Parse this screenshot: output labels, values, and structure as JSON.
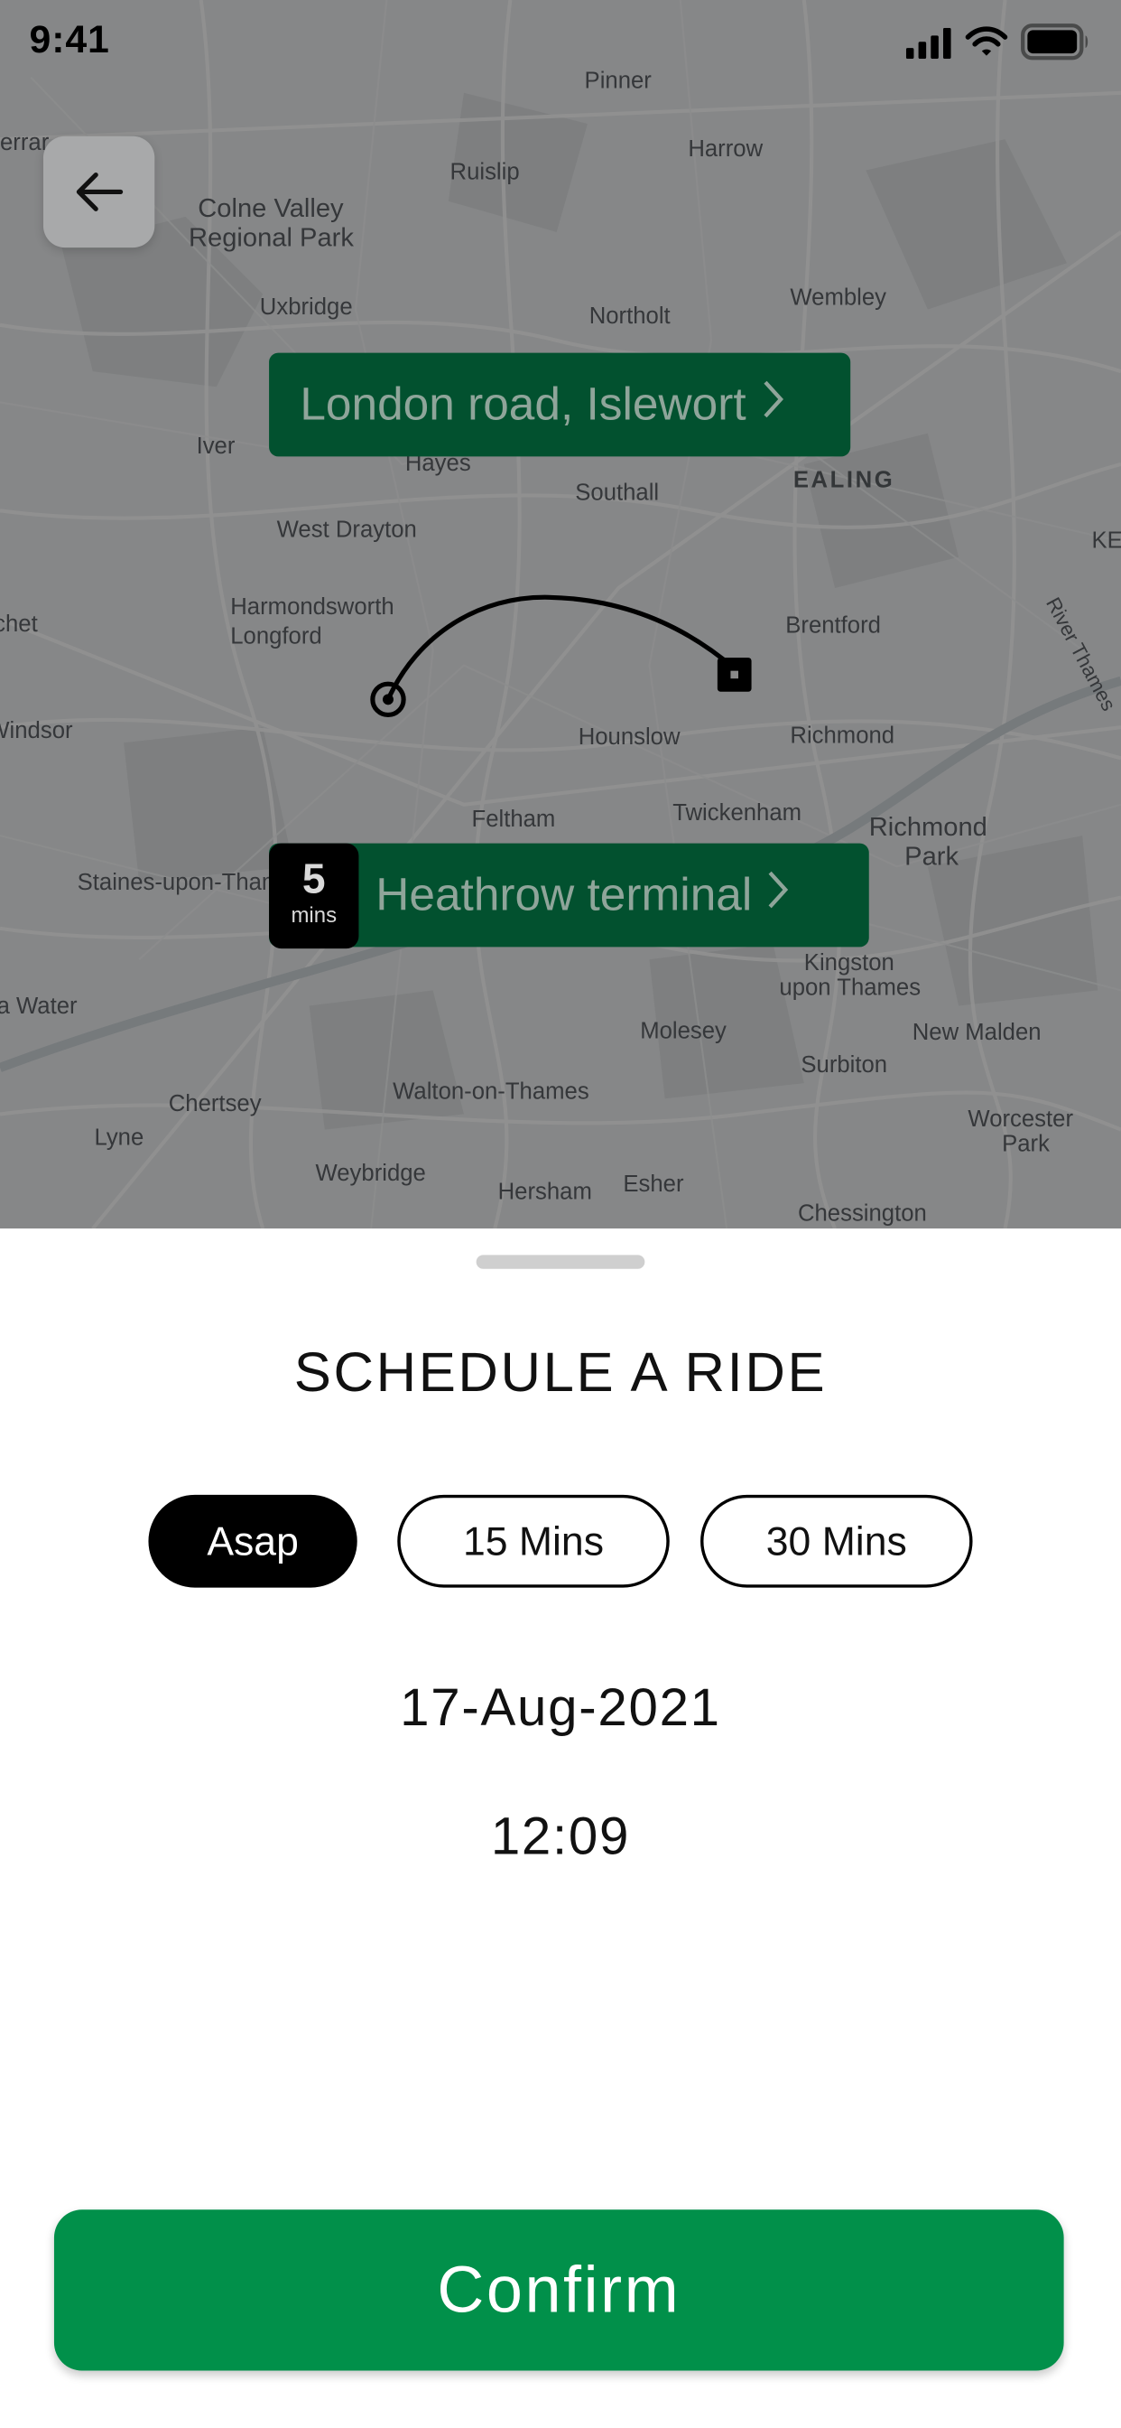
{
  "status_bar": {
    "time": "9:41"
  },
  "map": {
    "labels": [
      "Pinner",
      "Harrow",
      "Ruislip",
      "Colne Valley",
      "Regional Park",
      "Uxbridge",
      "Northolt",
      "Wembley",
      "Iver",
      "Hayes",
      "Southall",
      "EALING",
      "West Drayton",
      "Harmondsworth",
      "Longford",
      "Brentford",
      "Hounslow",
      "Richmond",
      "Feltham",
      "Twickenham",
      "Richmond",
      "Park",
      "Staines-upon-Thames",
      "Kingston",
      "upon Thames",
      "Molesey",
      "New Malden",
      "Surbiton",
      "Chertsey",
      "Walton-on-Thames",
      "Worcester",
      "Park",
      "Lyne",
      "Weybridge",
      "Hersham",
      "Esher",
      "Chessington",
      "Windsor",
      "River Thames",
      "a Water",
      "chet",
      "KE",
      "Serrar"
    ]
  },
  "route": {
    "origin": "London road, Islewort",
    "destination": "Heathrow terminal",
    "eta_value": "5",
    "eta_unit": "mins"
  },
  "sheet": {
    "title": "SCHEDULE A RIDE",
    "options": [
      "Asap",
      "15 Mins",
      "30 Mins"
    ],
    "selected_option": "Asap",
    "date": "17-Aug-2021",
    "time": "12:09",
    "confirm_label": "Confirm"
  },
  "colors": {
    "brand_green": "#01904a",
    "pill_green": "#02512f",
    "selected_chip": "#000000"
  },
  "icons": [
    "arrow-left-icon",
    "signal-icon",
    "wifi-icon",
    "battery-icon",
    "chevron-right-icon"
  ]
}
